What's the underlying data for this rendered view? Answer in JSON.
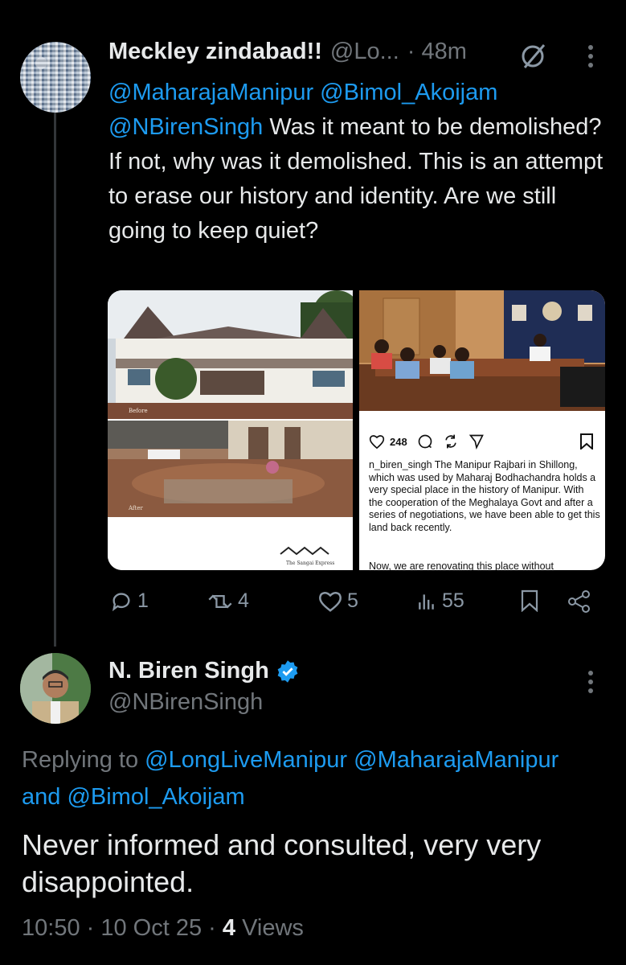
{
  "tweet": {
    "author_name": "Meckley zindabad!!",
    "handle": "@Lo...",
    "time": "· 48m",
    "mentions_line1": [
      "@MaharajaManipur",
      "@Bimol_Akoijam"
    ],
    "mention_line2": "@NBirenSingh",
    "text_after_mentions": "Was it meant to be demolished? If not, why was it demolished. This is an attempt to erase our history and identity. Are we still going to keep quiet?",
    "image_left": {
      "caption_before": "Before",
      "caption_after": "After",
      "credit": "The Sangai Express"
    },
    "image_right": {
      "likes": "248",
      "post_text": "n_biren_singh The Manipur Rajbari in Shillong, which was used by Maharaj Bodhachandra holds a very special place in the history of Manipur. With the cooperation of the Meghalaya Govt and after a series of negotiations, we have been able to get this land back recently.",
      "post_text_cut": "Now, we are renovating this place without"
    },
    "stats": {
      "replies": "1",
      "reposts": "4",
      "likes": "5",
      "views": "55"
    }
  },
  "reply": {
    "author_name": "N. Biren Singh",
    "handle": "@NBirenSingh",
    "replying_label": "Replying to",
    "replying_to": [
      "@LongLiveManipur",
      "@MaharajaManipur"
    ],
    "and_label": "and",
    "replying_to_last": "@Bimol_Akoijam",
    "text": "Never informed and consulted, very very disappointed.",
    "time": "10:50",
    "date": "10 Oct 25",
    "views_count": "4",
    "views_label": "Views"
  },
  "colors": {
    "accent": "#1d9bf0",
    "muted": "#71767b",
    "text": "#e7e9ea",
    "background": "#000000"
  },
  "icons": [
    "reply-icon",
    "repost-icon",
    "like-icon",
    "views-icon",
    "bookmark-icon",
    "share-icon",
    "grok-icon",
    "more-icon",
    "verified-icon"
  ]
}
